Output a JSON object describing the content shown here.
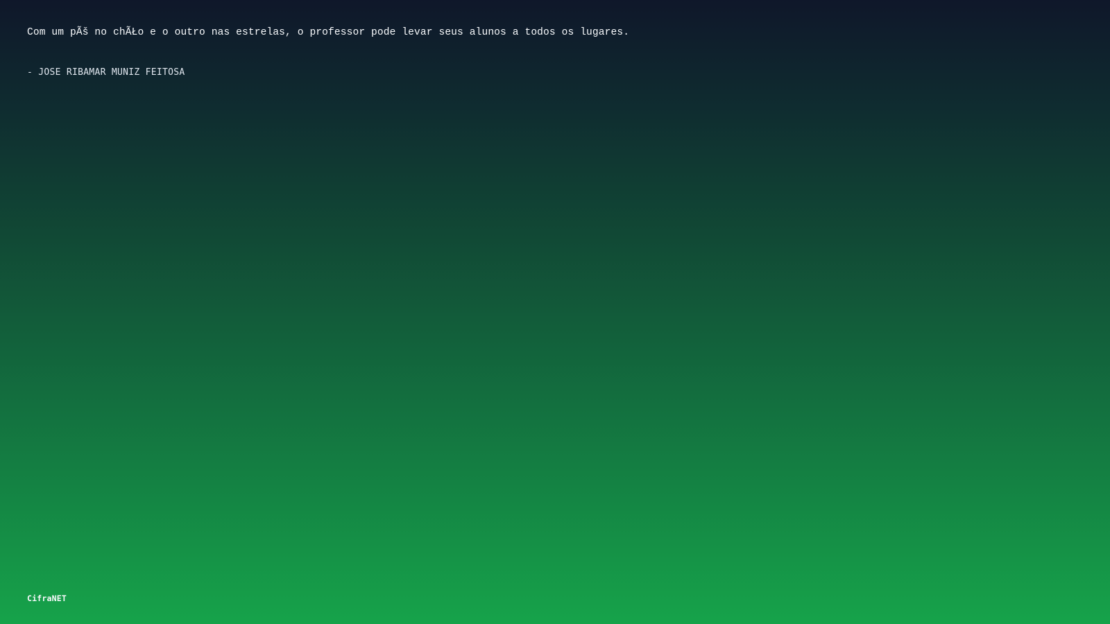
{
  "quote": {
    "text": "Com um pÃš no chÃŁo e o outro nas estrelas, o professor pode levar seus alunos a todos os lugares.",
    "author": "- JOSE RIBAMAR MUNIZ FEITOSA"
  },
  "brand": {
    "name": "CifraNET"
  },
  "colors": {
    "gradient_top": "#0f172a",
    "gradient_bottom": "#16a34a",
    "text": "#f8fafc"
  }
}
